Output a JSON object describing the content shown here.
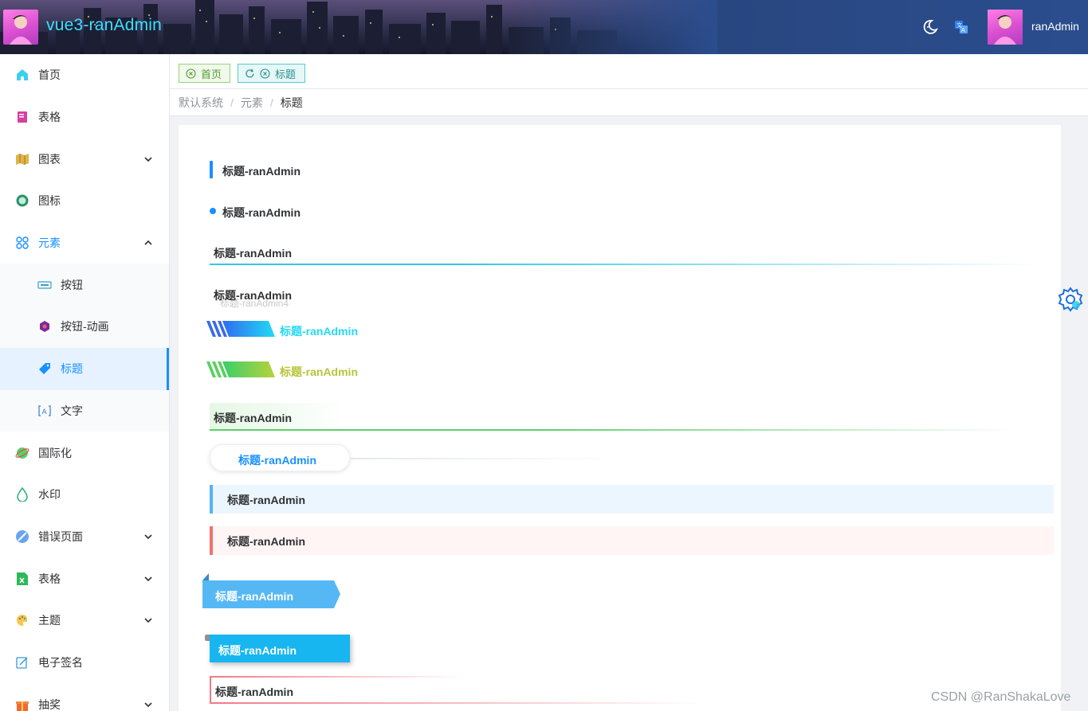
{
  "app": {
    "title": "vue3-ranAdmin",
    "user_name": "ranAdmin"
  },
  "header": {
    "icons": [
      "moon-icon",
      "translate-icon"
    ]
  },
  "sidebar": {
    "items": [
      {
        "label": "首页",
        "icon": "home-icon"
      },
      {
        "label": "表格",
        "icon": "book-icon"
      },
      {
        "label": "图表",
        "icon": "map-icon",
        "expandable": true
      },
      {
        "label": "图标",
        "icon": "badge-icon"
      },
      {
        "label": "元素",
        "icon": "command-icon",
        "expanded": true
      },
      {
        "label": "按钮",
        "icon": "btn-icon",
        "sub": true
      },
      {
        "label": "按钮-动画",
        "icon": "hexagon-icon",
        "sub": true
      },
      {
        "label": "标题",
        "icon": "tag-icon",
        "sub": true,
        "active": true
      },
      {
        "label": "文字",
        "icon": "text-icon",
        "sub": true
      },
      {
        "label": "国际化",
        "icon": "globe-icon"
      },
      {
        "label": "水印",
        "icon": "drop-icon"
      },
      {
        "label": "错误页面",
        "icon": "error-icon",
        "expandable": true
      },
      {
        "label": "表格",
        "icon": "excel-icon",
        "expandable": true
      },
      {
        "label": "主题",
        "icon": "palette-icon",
        "expandable": true
      },
      {
        "label": "电子签名",
        "icon": "sign-icon"
      },
      {
        "label": "抽奖",
        "icon": "gift-icon",
        "expandable": true
      }
    ]
  },
  "tabs": [
    {
      "label": "首页"
    },
    {
      "label": "标题"
    }
  ],
  "breadcrumb": [
    "默认系统",
    "元素",
    "标题"
  ],
  "titles": {
    "text": "标题-ranAdmin",
    "shadow_text": "标题-ranAdmin4"
  },
  "colors": {
    "accent": "#1890ff",
    "cyan": "#3ae0ff"
  },
  "watermark": "CSDN @RanShakaLove"
}
